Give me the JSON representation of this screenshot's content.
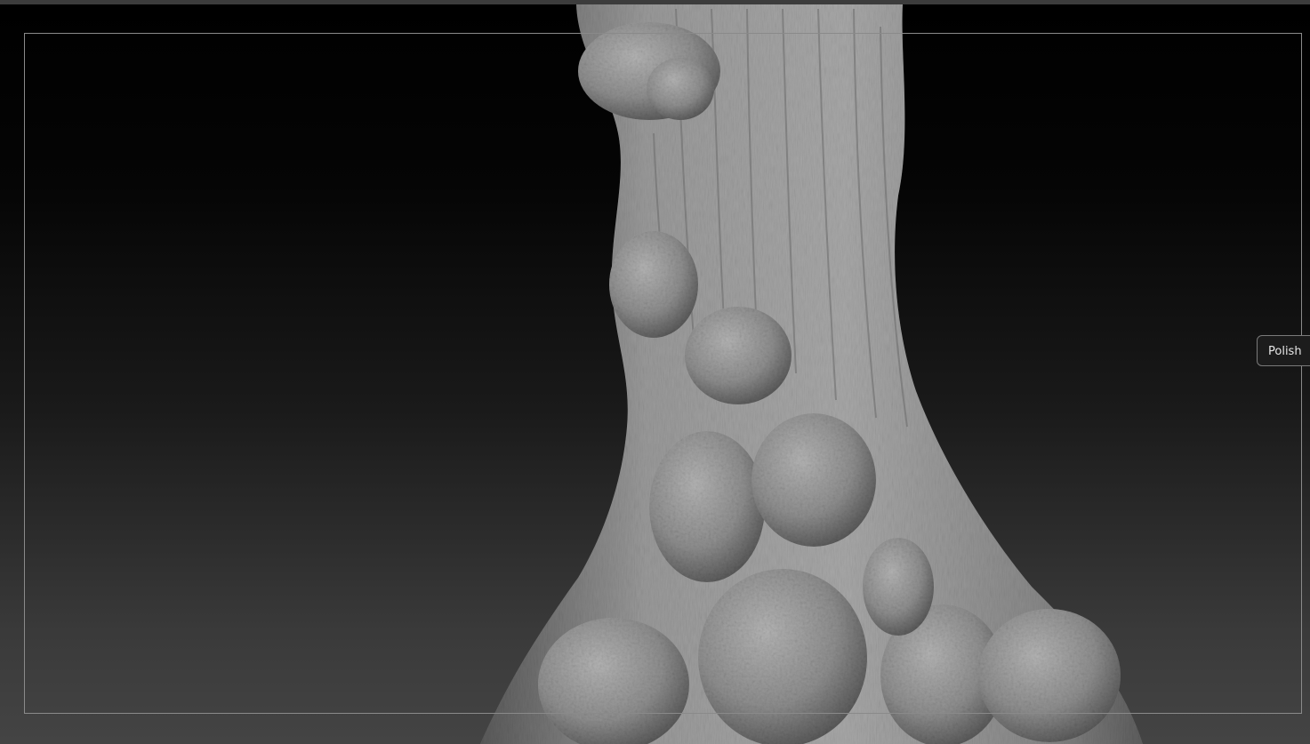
{
  "canvas": {
    "background_top": "#000000",
    "background_bottom": "#444444",
    "model_color": "#8c8c8c",
    "model_highlight": "#b0b0b0",
    "model_shadow": "#4a4a4a",
    "frame_color": "#8a8a8a",
    "model_icon": "tree-trunk-sculpt"
  },
  "polish_button": {
    "label": "Polish"
  }
}
